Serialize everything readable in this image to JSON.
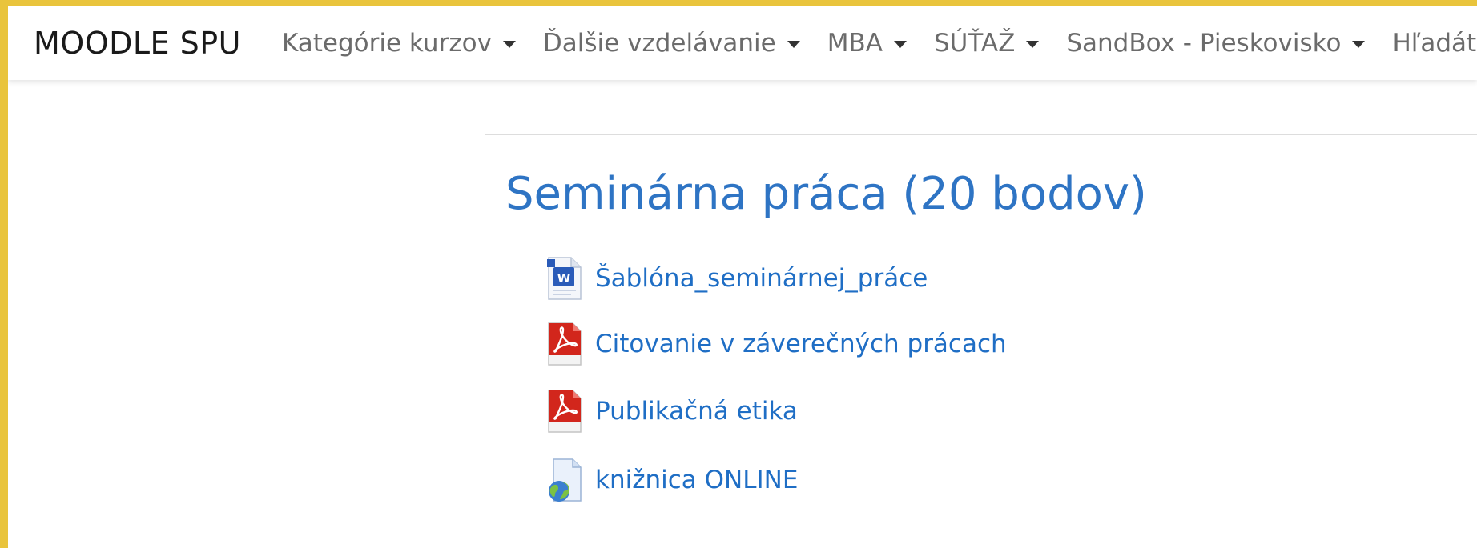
{
  "navbar": {
    "brand": "MOODLE SPU",
    "menu": [
      {
        "label": "Kategórie kurzov"
      },
      {
        "label": "Ďalšie vzdelávanie"
      },
      {
        "label": "MBA"
      },
      {
        "label": "SÚŤAŽ"
      },
      {
        "label": "SandBox - Pieskovisko"
      },
      {
        "label": "Hľadáte k"
      }
    ]
  },
  "section": {
    "title": "Seminárna práca (20 bodov)",
    "activities": [
      {
        "label": "Šablóna_seminárnej_práce",
        "icon": "word-document-icon"
      },
      {
        "label": "Citovanie v záverečných prácach",
        "icon": "pdf-file-icon"
      },
      {
        "label": "Publikačná etika",
        "icon": "pdf-file-icon"
      },
      {
        "label": "knižnica ONLINE",
        "icon": "url-globe-icon"
      }
    ]
  },
  "colors": {
    "frame": "#e9c43c",
    "link": "#1f6ec5",
    "title": "#2e74c4",
    "nav_text": "#6b6b6b",
    "pdf_red": "#d2261c",
    "word_blue": "#2a5bb8"
  }
}
